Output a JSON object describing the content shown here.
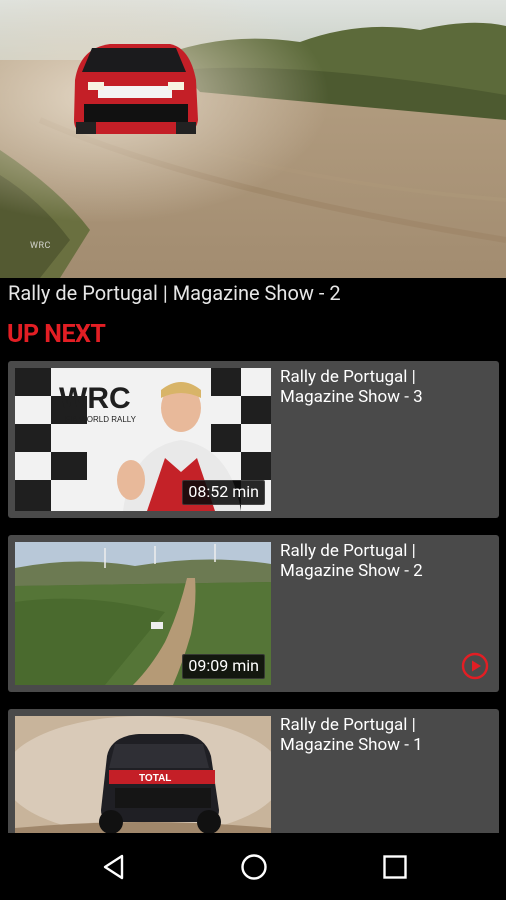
{
  "player": {
    "video_title": "Rally de Portugal | Magazine Show - 2",
    "watermark": "WRC"
  },
  "up_next": {
    "heading": "UP NEXT",
    "items": [
      {
        "title": "Rally de Portugal | Magazine Show - 3",
        "duration": "08:52 min",
        "playing": false
      },
      {
        "title": "Rally de Portugal | Magazine Show - 2",
        "duration": "09:09 min",
        "playing": true
      },
      {
        "title": "Rally de Portugal | Magazine Show - 1",
        "duration": "",
        "playing": false
      }
    ]
  },
  "thumb_text": {
    "wrc_logo": "WRC",
    "wrc_subtitle": "FIA WORLD RALLY",
    "car_livery": "TOTAL"
  },
  "navbar": {
    "icons": [
      "back-icon",
      "home-icon",
      "recents-icon"
    ]
  },
  "colors": {
    "accent": "#e31e24",
    "card_bg": "#4a4a4a",
    "background": "#000000"
  }
}
